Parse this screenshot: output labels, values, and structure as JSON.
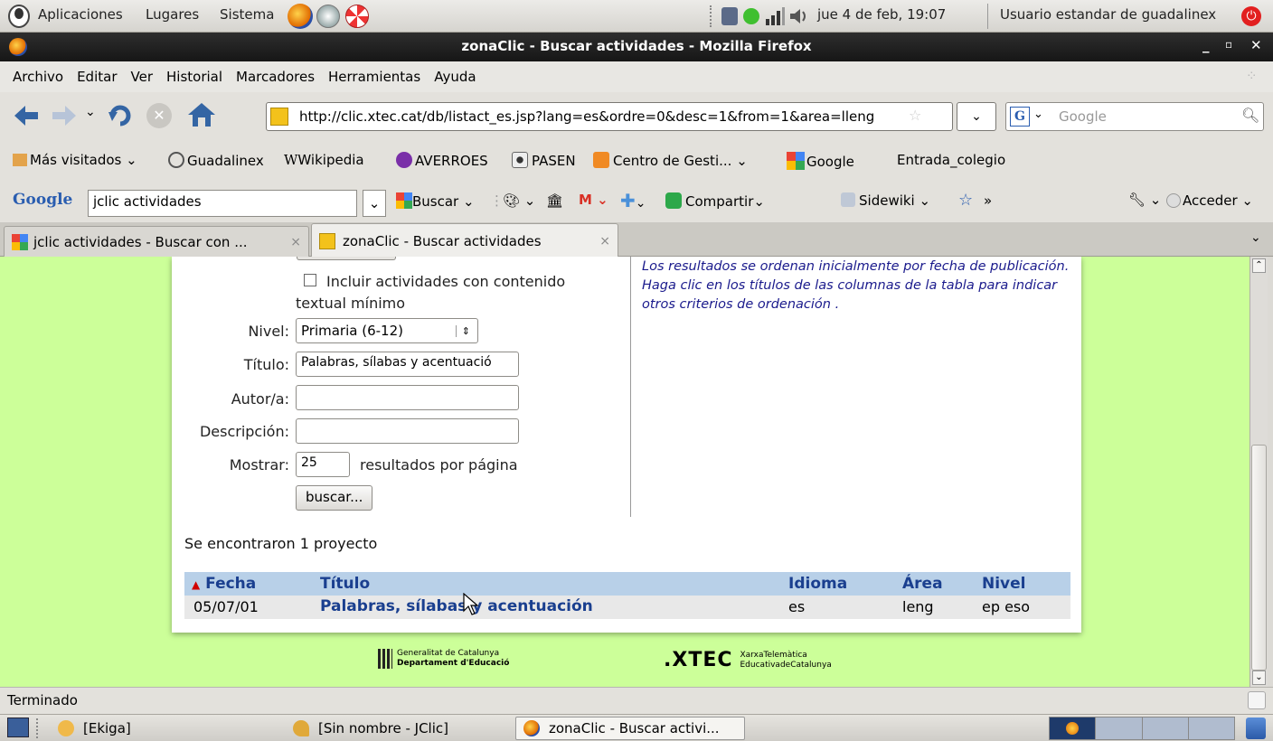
{
  "top_panel": {
    "menus": [
      "Aplicaciones",
      "Lugares",
      "Sistema"
    ],
    "clock": "jue  4 de feb, 19:07",
    "user": "Usuario estandar de guadalinex"
  },
  "window": {
    "title": "zonaClic - Buscar actividades - Mozilla Firefox"
  },
  "menubar": [
    "Archivo",
    "Editar",
    "Ver",
    "Historial",
    "Marcadores",
    "Herramientas",
    "Ayuda"
  ],
  "nav": {
    "url": "http://clic.xtec.cat/db/listact_es.jsp?lang=es&ordre=0&desc=1&from=1&area=lleng",
    "search_placeholder": "Google"
  },
  "bookmarks": [
    "Más visitados",
    "Guadalinex",
    "Wikipedia",
    "AVERROES",
    "PASEN",
    "Centro de Gesti...",
    "Google",
    "Entrada_colegio"
  ],
  "google_toolbar": {
    "logo": "Google",
    "query": "jclic actividades",
    "buscar": "Buscar",
    "compartir": "Compartir",
    "sidewiki": "Sidewiki",
    "more": "»",
    "acceder": "Acceder"
  },
  "tabs": [
    {
      "label": "jclic actividades - Buscar con ..."
    },
    {
      "label": "zonaClic - Buscar actividades"
    }
  ],
  "form": {
    "checkbox_label": "Incluir actividades con contenido textual mínimo",
    "nivel_label": "Nivel:",
    "nivel_value": "Primaria (6-12)",
    "titulo_label": "Título:",
    "titulo_value": "Palabras, sílabas y acentuació",
    "autor_label": "Autor/a:",
    "autor_value": "",
    "descripcion_label": "Descripción:",
    "descripcion_value": "",
    "mostrar_label": "Mostrar:",
    "mostrar_value": "25",
    "mostrar_suffix": "resultados por página",
    "buscar_button": "buscar..."
  },
  "info_text": "Los resultados se ordenan inicialmente por fecha de publicación. Haga clic en los títulos de las columnas de la tabla para indicar otros criterios de ordenación .",
  "results": {
    "summary": "Se encontraron 1 proyecto",
    "headers": {
      "fecha": "Fecha",
      "titulo": "Título",
      "idioma": "Idioma",
      "area": "Área",
      "nivel": "Nivel"
    },
    "rows": [
      {
        "fecha": "05/07/01",
        "titulo": "Palabras, sílabas y acentuación",
        "idioma": "es",
        "area": "leng",
        "nivel": "ep eso"
      }
    ]
  },
  "footer": {
    "gencat_line1": "Generalitat de Catalunya",
    "gencat_line2": "Departament d'Educació",
    "xtec_logo": ".XTEC",
    "xtec_line1": "XarxaTelemàtica",
    "xtec_line2": "EducativadeCatalunya"
  },
  "statusbar": "Terminado",
  "taskbar": [
    "[Ekiga]",
    "[Sin nombre - JClic]",
    "zonaClic - Buscar activi..."
  ],
  "colors": {
    "content_bg": "#ccff99",
    "table_header_bg": "#b8d0e8",
    "link": "#1a3f8f",
    "info_text": "#1a1a8c"
  }
}
